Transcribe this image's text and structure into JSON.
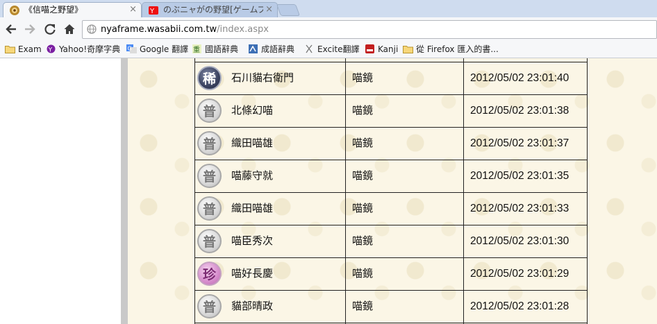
{
  "tabs": [
    {
      "title": "《信喵之野望》",
      "active": true,
      "close": "×"
    },
    {
      "title": "のぶニャがの野望[ゲームプ",
      "active": false,
      "close": "×"
    }
  ],
  "url": {
    "host": "nyaframe.wasabii.com.tw",
    "path": "/index.aspx"
  },
  "bookmarks": [
    {
      "label": "Exam",
      "icon": "folder-icon"
    },
    {
      "label": "Yahoo!奇摩字典",
      "icon": "yahoo-icon"
    },
    {
      "label": "Google 翻譯",
      "icon": "google-translate-icon"
    },
    {
      "label": "國語辭典",
      "icon": "dictionary-icon"
    },
    {
      "label": "成語辭典",
      "icon": "idiom-icon"
    },
    {
      "label": "Excite翻譯",
      "icon": "excite-icon"
    },
    {
      "label": "Kanji",
      "icon": "kanji-icon"
    },
    {
      "label": "從 Firefox 匯入的書...",
      "icon": "folder-icon"
    }
  ],
  "rows": [
    {
      "badge": "稀",
      "rarity": "rare",
      "name": "石川貓右衛門",
      "group": "喵鏡",
      "time": "2012/05/02 23:01:40"
    },
    {
      "badge": "普",
      "rarity": "common",
      "name": "北條幻喵",
      "group": "喵鏡",
      "time": "2012/05/02 23:01:38"
    },
    {
      "badge": "普",
      "rarity": "common",
      "name": "織田喵雄",
      "group": "喵鏡",
      "time": "2012/05/02 23:01:37"
    },
    {
      "badge": "普",
      "rarity": "common",
      "name": "喵藤守就",
      "group": "喵鏡",
      "time": "2012/05/02 23:01:35"
    },
    {
      "badge": "普",
      "rarity": "common",
      "name": "織田喵雄",
      "group": "喵鏡",
      "time": "2012/05/02 23:01:33"
    },
    {
      "badge": "普",
      "rarity": "common",
      "name": "喵臣秀次",
      "group": "喵鏡",
      "time": "2012/05/02 23:01:30"
    },
    {
      "badge": "珍",
      "rarity": "treasure",
      "name": "喵好長慶",
      "group": "喵鏡",
      "time": "2012/05/02 23:01:29"
    },
    {
      "badge": "普",
      "rarity": "common",
      "name": "貓部晴政",
      "group": "喵鏡",
      "time": "2012/05/02 23:01:28"
    }
  ],
  "colors": {
    "rare": "#3a4260",
    "common": "#d8d8d8",
    "treasure": "#d68ccc",
    "paper": "#fbf6e6"
  }
}
